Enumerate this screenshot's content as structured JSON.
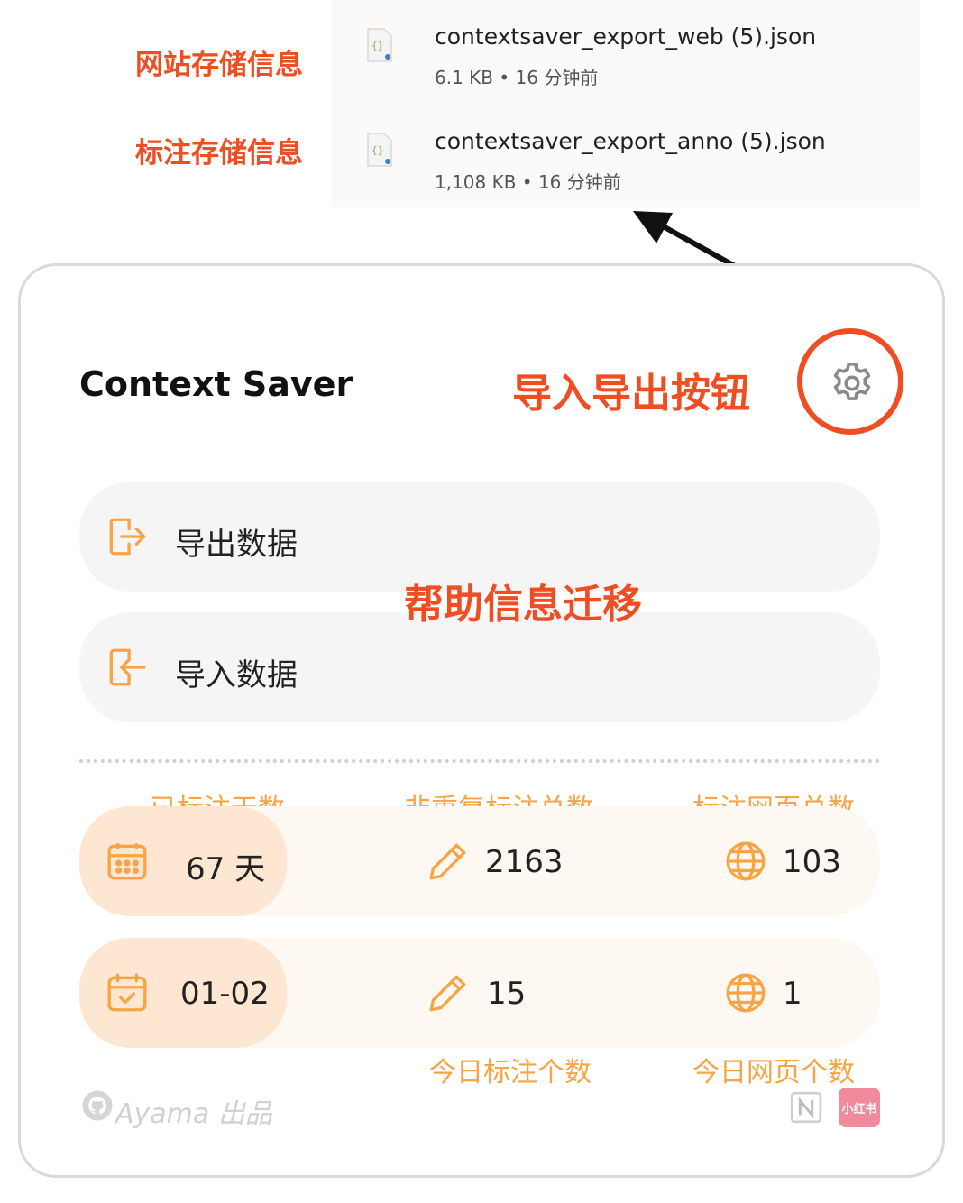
{
  "files": [
    {
      "annotation": "网站存储信息",
      "name": "contextsaver_export_web (5).json",
      "meta": "6.1 KB • 16 分钟前",
      "icon": "json-file-icon"
    },
    {
      "annotation": "标注存储信息",
      "name": "contextsaver_export_anno (5).json",
      "meta": "1,108 KB • 16 分钟前",
      "icon": "json-file-icon"
    }
  ],
  "app": {
    "title": "Context Saver"
  },
  "annotations": {
    "settings": "导入导出按钮",
    "migrate": "帮助信息迁移"
  },
  "actions": {
    "export_label": "导出数据",
    "import_label": "导入数据"
  },
  "stats": {
    "labels": {
      "days": "已标注天数",
      "unique": "非重复标注总数",
      "pages": "标注网页总数",
      "today_count": "今日标注个数",
      "today_pages": "今日网页个数"
    },
    "days_value": "67 天",
    "unique_value": "2163",
    "pages_value": "103",
    "date_value": "01-02",
    "today_count_value": "15",
    "today_pages_value": "1"
  },
  "footer": {
    "credit": "Ayama 出品",
    "badge": "小红书"
  },
  "colors": {
    "accent": "#f7a544",
    "annotation": "#ef4d22",
    "pill": "#fde6d2"
  },
  "icons": [
    "gear-icon",
    "export-icon",
    "import-icon",
    "calendar-icon",
    "calendar-check-icon",
    "pencil-icon",
    "globe-icon",
    "github-icon",
    "notion-icon"
  ]
}
